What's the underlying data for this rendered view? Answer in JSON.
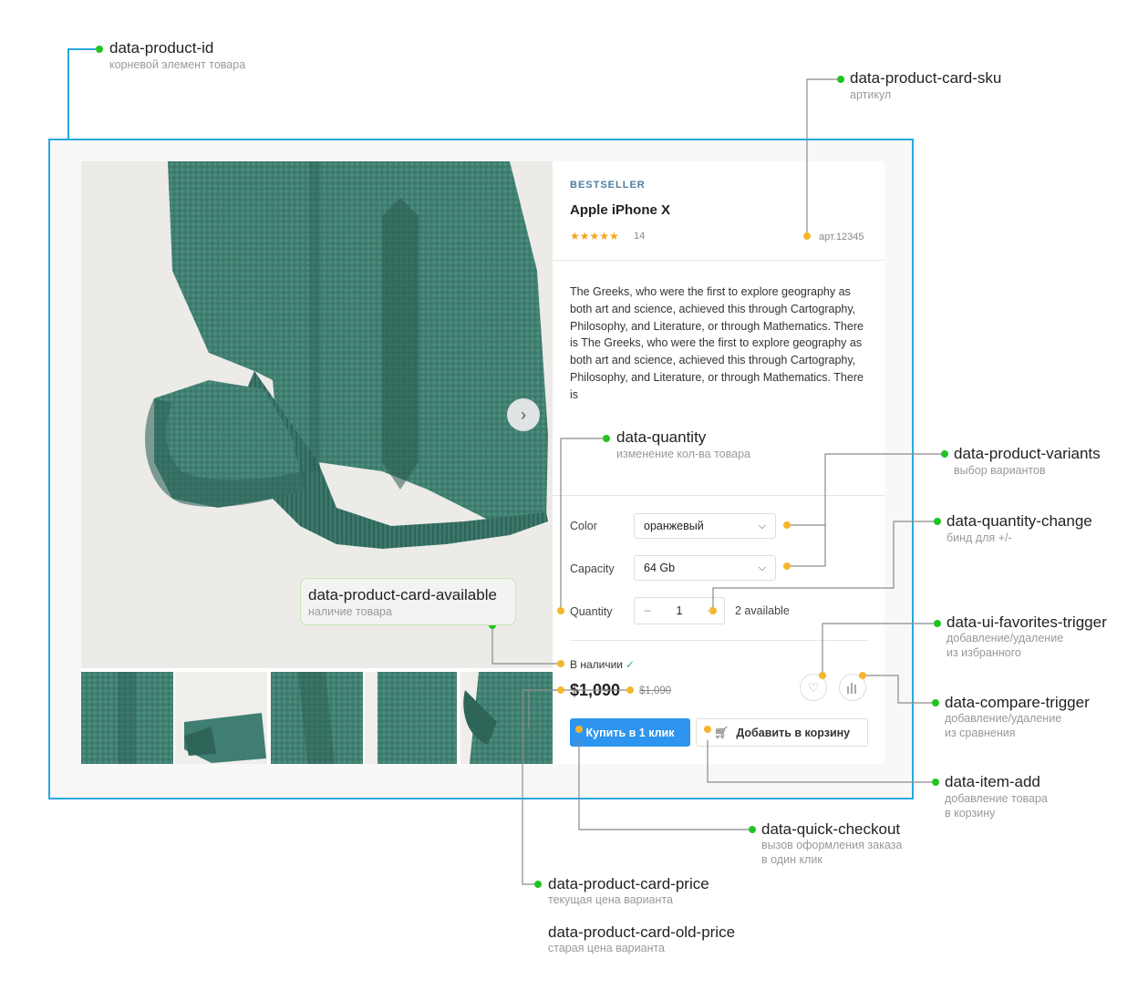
{
  "product": {
    "badge": "BESTSELLER",
    "title": "Apple iPhone X",
    "stars": "★★★★★",
    "rating_value": 4.5,
    "review_count": "14",
    "sku": "арт.12345",
    "description": "The Greeks, who were the first to explore geography as both art and science, achieved this through Cartography, Philosophy, and Literature, or through Mathematics. There is The Greeks, who were the first to explore geography as both art and science, achieved this through Cartography, Philosophy, and Literature, or through Mathematics. There is",
    "fields": {
      "color_label": "Color",
      "color_value": "оранжевый",
      "capacity_label": "Capacity",
      "capacity_value": "64 Gb",
      "quantity_label": "Quantity",
      "quantity_value": "1",
      "quantity_minus": "−",
      "quantity_plus": "+",
      "available_count": "2 available"
    },
    "stock_status": "В наличии",
    "stock_check": "✓",
    "price": "$1,090",
    "old_price": "$1,090",
    "buy_one_click": "Купить в 1 клик",
    "add_to_cart": "Добавить в корзину",
    "next_arrow": "›",
    "thumbnail_count": 5
  },
  "icons": {
    "next": "chevron-right-icon",
    "favorites": "heart-icon",
    "compare": "bar-chart-icon",
    "cart": "cart-icon",
    "select": "chevron-down-icon"
  },
  "colors": {
    "frame": "#29a8df",
    "accent_button": "#2d95ef",
    "badge": "#4b7ea3",
    "stars": "#f3a51a",
    "green_dot": "#22c322",
    "yellow_dot": "#f5b62d",
    "sweater": "#3f7e70"
  },
  "annotations": {
    "product_id": {
      "title": "data-product-id",
      "sub": "корневой элемент товара"
    },
    "sku": {
      "title": "data-product-card-sku",
      "sub": "артикул"
    },
    "quantity": {
      "title": "data-quantity",
      "sub": "изменение кол-ва товара"
    },
    "variants": {
      "title": "data-product-variants",
      "sub": "выбор вариантов"
    },
    "quantity_change": {
      "title": "data-quantity-change",
      "sub": "бинд для +/-"
    },
    "available": {
      "title": "data-product-card-available",
      "sub": "наличие товара"
    },
    "favorites": {
      "title": "data-ui-favorites-trigger",
      "sub1": "добавление/удаление",
      "sub2": "из избранного"
    },
    "compare": {
      "title": "data-compare-trigger",
      "sub1": "добавление/удаление",
      "sub2": "из сравнения"
    },
    "item_add": {
      "title": "data-item-add",
      "sub1": "добавление товара",
      "sub2": "в корзину"
    },
    "quick_checkout": {
      "title": "data-quick-checkout",
      "sub1": "вызов оформления заказа",
      "sub2": "в один клик"
    },
    "price": {
      "title": "data-product-card-price",
      "sub": "текущая цена варианта"
    },
    "old_price": {
      "title": "data-product-card-old-price",
      "sub": "старая цена варианта"
    }
  }
}
